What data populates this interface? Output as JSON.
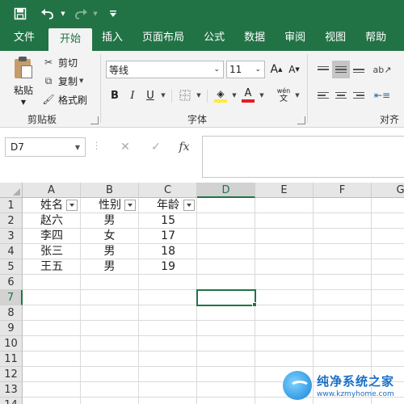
{
  "tabs": [
    {
      "label": "文件",
      "active": false
    },
    {
      "label": "开始",
      "active": true
    },
    {
      "label": "插入",
      "active": false
    },
    {
      "label": "页面布局",
      "active": false
    },
    {
      "label": "公式",
      "active": false
    },
    {
      "label": "数据",
      "active": false
    },
    {
      "label": "审阅",
      "active": false
    },
    {
      "label": "视图",
      "active": false
    },
    {
      "label": "帮助",
      "active": false
    }
  ],
  "ribbon": {
    "clipboard": {
      "paste_label": "粘贴",
      "cut_label": "剪切",
      "copy_label": "复制",
      "format_painter_label": "格式刷",
      "group_label": "剪贴板"
    },
    "font": {
      "font_name": "等线",
      "font_size": "11",
      "grow": "A",
      "shrink": "A",
      "bold": "B",
      "italic": "I",
      "underline": "U",
      "font_color": "A",
      "phonetic_top": "wén",
      "phonetic_bottom": "文",
      "group_label": "字体"
    },
    "alignment": {
      "group_label": "对齐方"
    }
  },
  "formula_bar": {
    "name_box": "D7",
    "cancel": "✕",
    "enter": "✓",
    "fx": "fx",
    "formula": ""
  },
  "sheet": {
    "columns": [
      "A",
      "B",
      "C",
      "D",
      "E",
      "F",
      "G"
    ],
    "rows": [
      "1",
      "2",
      "3",
      "4",
      "5",
      "6",
      "7",
      "8",
      "9",
      "10",
      "11",
      "12",
      "13",
      "14"
    ],
    "headers": [
      "姓名",
      "性别",
      "年龄"
    ],
    "data": [
      [
        "赵六",
        "男",
        "15"
      ],
      [
        "李四",
        "女",
        "17"
      ],
      [
        "张三",
        "男",
        "18"
      ],
      [
        "王五",
        "男",
        "19"
      ]
    ],
    "active_cell": "D7"
  },
  "watermark": {
    "title": "纯净系统之家",
    "url": "www.kzmyhome.com"
  },
  "colors": {
    "accent": "#217346",
    "ribbon_bg": "#f3f3f3",
    "header_bg": "#e6e6e6",
    "font_color_bar": "#e51c23",
    "highlight_bar": "#ffeb3b"
  }
}
